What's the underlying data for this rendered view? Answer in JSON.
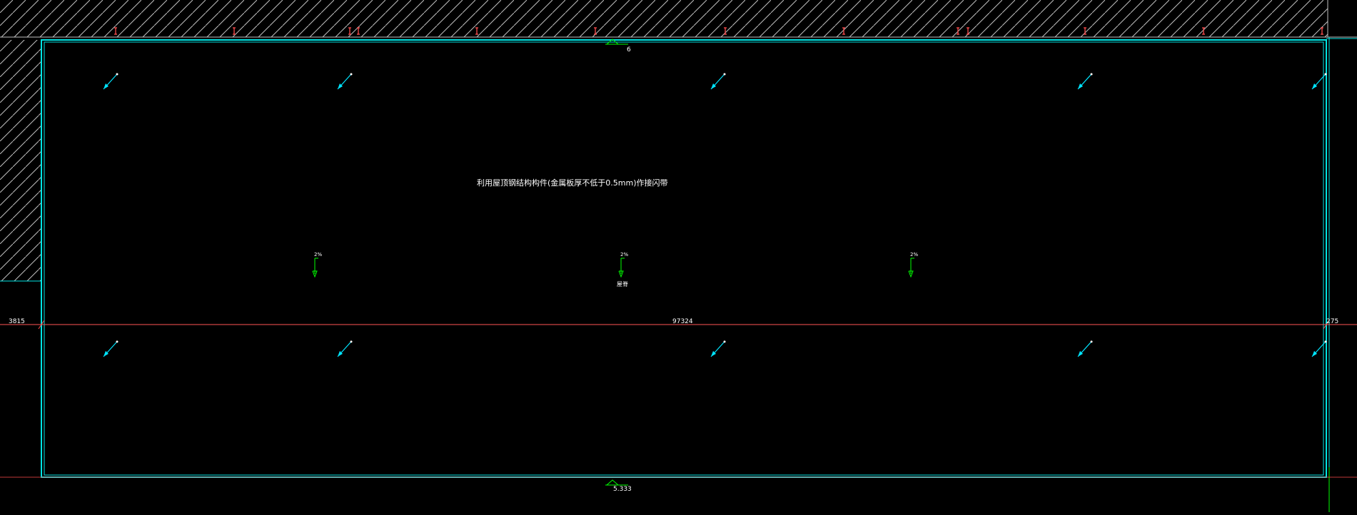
{
  "drawing": {
    "note": "利用屋顶钢结构构件(金属板厚不低于0.5mm)作接闪带",
    "elevation_top": "6",
    "elevation_bottom": "5.333",
    "ridge_label": "屋脊",
    "dim_left": "3815",
    "dim_main": "97324",
    "dim_right": "275",
    "slopes": [
      "2%",
      "2%",
      "2%"
    ],
    "colors": {
      "background": "#000000",
      "outline": "#00e5e5",
      "dimension": "#ff5555",
      "text": "#ffffff",
      "slope_arrow": "#00ff00",
      "elevation_marker": "#00ff00",
      "hatch": "#bfbfbf",
      "grid_tick": "#ff4d4d",
      "air_terminal": "#00e5ff"
    }
  }
}
